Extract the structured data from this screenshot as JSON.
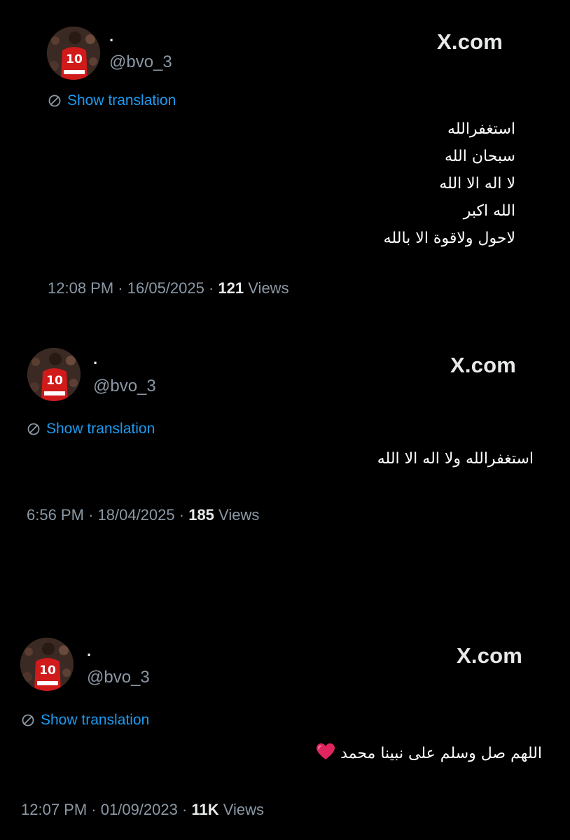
{
  "brand_label": "X.com",
  "tweets": [
    {
      "display_name": "·",
      "handle": "@bvo_3",
      "show_translation": "Show translation",
      "text_lines": [
        "استغفرالله",
        "سبحان الله",
        "لا اله الا الله",
        "الله اكبر",
        "لاحول ولاقوة الا بالله"
      ],
      "time": "12:08 PM",
      "date": "16/05/2025",
      "views_count": "121",
      "views_label": "Views"
    },
    {
      "display_name": "·",
      "handle": "@bvo_3",
      "show_translation": "Show translation",
      "text_lines": [
        "استغفرالله ولا اله الا الله"
      ],
      "time": "6:56 PM",
      "date": "18/04/2025",
      "views_count": "185",
      "views_label": "Views"
    },
    {
      "display_name": "·",
      "handle": "@bvo_3",
      "show_translation": "Show translation",
      "text_lines": [
        "اللهم صل وسلم على نبينا محمد"
      ],
      "emoji": "red-heart",
      "time": "12:07 PM",
      "date": "01/09/2023",
      "views_count": "11K",
      "views_label": "Views"
    }
  ],
  "colors": {
    "background": "#000000",
    "link": "#1d9bf0",
    "muted": "#8b98a5",
    "text": "#e7e9ea",
    "heart": "#e0245e"
  },
  "icons": {
    "translate": "translate-globe-icon",
    "avatar": "player-number-10-avatar",
    "heart": "red-heart-icon"
  }
}
